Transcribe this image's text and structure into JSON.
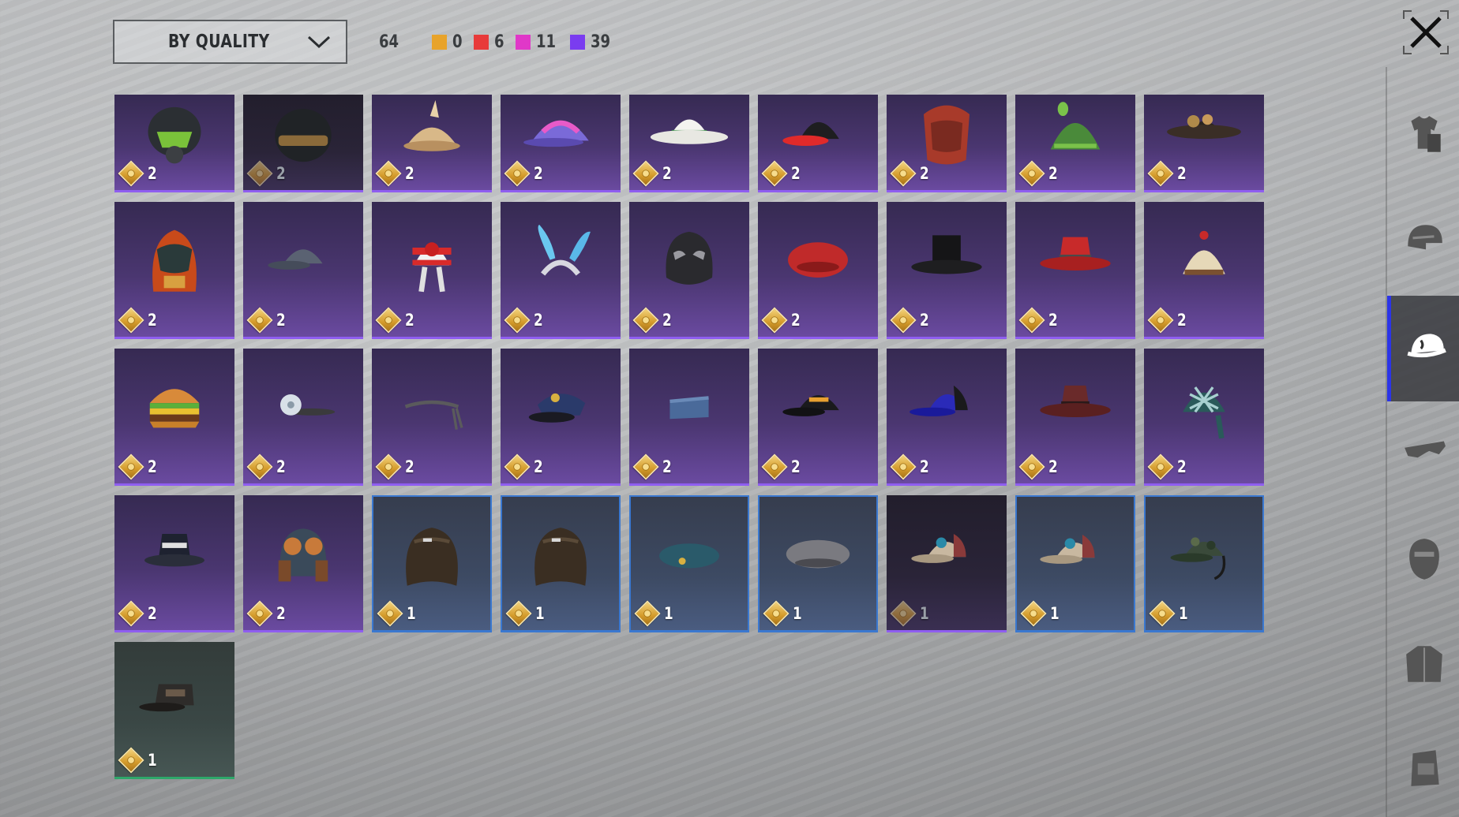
{
  "toolbar": {
    "sort_label": "BY QUALITY",
    "total_count": "64",
    "quality_counts": [
      {
        "name": "legendary",
        "color": "#e8a32a",
        "count": "0"
      },
      {
        "name": "mythic",
        "color": "#e83a3a",
        "count": "6"
      },
      {
        "name": "epic-pink",
        "color": "#e038c8",
        "count": "11"
      },
      {
        "name": "epic-purple",
        "color": "#7a3cf0",
        "count": "39"
      }
    ]
  },
  "colors": {
    "purple_quality": "#8f5ef0",
    "blue_quality": "#3a78d0",
    "green_quality": "#2ea86a",
    "active_tab": "#2b34e8"
  },
  "items": [
    {
      "icon": "gas-mask-helmet",
      "quality": "purple",
      "copies": "2"
    },
    {
      "icon": "visor-helmet",
      "quality": "dark",
      "copies": "2",
      "locked": true
    },
    {
      "icon": "deerstalker-hat",
      "quality": "purple",
      "copies": "2"
    },
    {
      "icon": "rainbow-cap",
      "quality": "purple",
      "copies": "2"
    },
    {
      "icon": "white-panama-hat",
      "quality": "purple",
      "copies": "2"
    },
    {
      "icon": "red-black-cap",
      "quality": "purple",
      "copies": "2"
    },
    {
      "icon": "red-headscarf",
      "quality": "purple",
      "copies": "2"
    },
    {
      "icon": "green-knit-hat",
      "quality": "purple",
      "copies": "2"
    },
    {
      "icon": "steampunk-hat",
      "quality": "purple",
      "copies": "2"
    },
    {
      "icon": "samurai-mask",
      "quality": "purple",
      "copies": "2"
    },
    {
      "icon": "grey-baseball-cap",
      "quality": "purple",
      "copies": "2"
    },
    {
      "icon": "striped-jester-hat",
      "quality": "purple",
      "copies": "2"
    },
    {
      "icon": "bunny-ears-headband",
      "quality": "purple",
      "copies": "2"
    },
    {
      "icon": "luchador-mask",
      "quality": "purple",
      "copies": "2"
    },
    {
      "icon": "red-beret",
      "quality": "purple",
      "copies": "2"
    },
    {
      "icon": "black-top-hat",
      "quality": "purple",
      "copies": "2"
    },
    {
      "icon": "red-fedora",
      "quality": "purple",
      "copies": "2"
    },
    {
      "icon": "cake-hat",
      "quality": "purple",
      "copies": "2"
    },
    {
      "icon": "burger-hat",
      "quality": "purple",
      "copies": "2"
    },
    {
      "icon": "headlamp-band",
      "quality": "purple",
      "copies": "2"
    },
    {
      "icon": "headband",
      "quality": "purple",
      "copies": "2"
    },
    {
      "icon": "pilot-cap",
      "quality": "purple",
      "copies": "2"
    },
    {
      "icon": "garrison-cap",
      "quality": "purple",
      "copies": "2"
    },
    {
      "icon": "gamer-cap",
      "quality": "purple",
      "copies": "2"
    },
    {
      "icon": "blue-trucker-cap",
      "quality": "purple",
      "copies": "2"
    },
    {
      "icon": "maroon-fedora",
      "quality": "purple",
      "copies": "2"
    },
    {
      "icon": "plaid-bandana",
      "quality": "purple",
      "copies": "2"
    },
    {
      "icon": "bucket-hat",
      "quality": "purple",
      "copies": "2"
    },
    {
      "icon": "aviator-helmet",
      "quality": "purple",
      "copies": "2"
    },
    {
      "icon": "brown-wig",
      "quality": "blue",
      "copies": "1"
    },
    {
      "icon": "brown-wig",
      "quality": "blue",
      "copies": "1"
    },
    {
      "icon": "blue-beret",
      "quality": "blue",
      "copies": "1"
    },
    {
      "icon": "grey-beret",
      "quality": "blue",
      "copies": "1"
    },
    {
      "icon": "beige-cap",
      "quality": "dark",
      "copies": "1",
      "locked": true
    },
    {
      "icon": "beige-cap",
      "quality": "blue",
      "copies": "1"
    },
    {
      "icon": "camo-headset-cap",
      "quality": "blue",
      "copies": "1"
    },
    {
      "icon": "military-patrol-cap",
      "quality": "green",
      "copies": "1"
    }
  ],
  "sidebar": [
    {
      "icon": "outfit-icon",
      "active": false
    },
    {
      "icon": "helmet-icon",
      "active": false
    },
    {
      "icon": "cap-icon",
      "active": true
    },
    {
      "icon": "glasses-icon",
      "active": false
    },
    {
      "icon": "mask-icon",
      "active": false
    },
    {
      "icon": "jacket-icon",
      "active": false
    },
    {
      "icon": "backpack-icon",
      "active": false
    }
  ]
}
